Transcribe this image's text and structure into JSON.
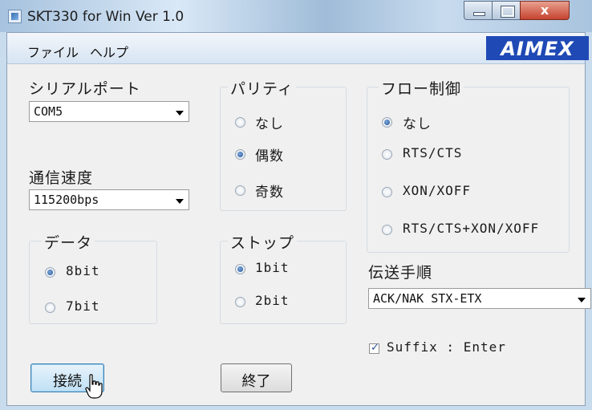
{
  "window": {
    "title": "SKT330 for Win Ver 1.0",
    "close_glyph": "x"
  },
  "menu": {
    "items": [
      "ファイル",
      "ヘルプ"
    ],
    "logo": "AIMEX"
  },
  "serial_port": {
    "label": "シリアルポート",
    "value": "COM5"
  },
  "baud_rate": {
    "label": "通信速度",
    "value": "115200bps"
  },
  "parity": {
    "legend": "パリティ",
    "options": [
      {
        "label": "なし",
        "selected": false
      },
      {
        "label": "偶数",
        "selected": true
      },
      {
        "label": "奇数",
        "selected": false
      }
    ]
  },
  "flow_control": {
    "legend": "フロー制御",
    "options": [
      {
        "label": "なし",
        "selected": true
      },
      {
        "label": "RTS/CTS",
        "selected": false
      },
      {
        "label": "XON/XOFF",
        "selected": false
      },
      {
        "label": "RTS/CTS+XON/XOFF",
        "selected": false
      }
    ]
  },
  "data_bits": {
    "legend": "データ",
    "options": [
      {
        "label": "8bit",
        "selected": true
      },
      {
        "label": "7bit",
        "selected": false
      }
    ]
  },
  "stop_bits": {
    "legend": "ストップ",
    "options": [
      {
        "label": "1bit",
        "selected": true
      },
      {
        "label": "2bit",
        "selected": false
      }
    ]
  },
  "protocol": {
    "label": "伝送手順",
    "value": "ACK/NAK STX-ETX"
  },
  "suffix": {
    "label": "Suffix : Enter",
    "checked": true,
    "check_glyph": "✓"
  },
  "buttons": {
    "connect": "接続",
    "exit": "終了"
  }
}
